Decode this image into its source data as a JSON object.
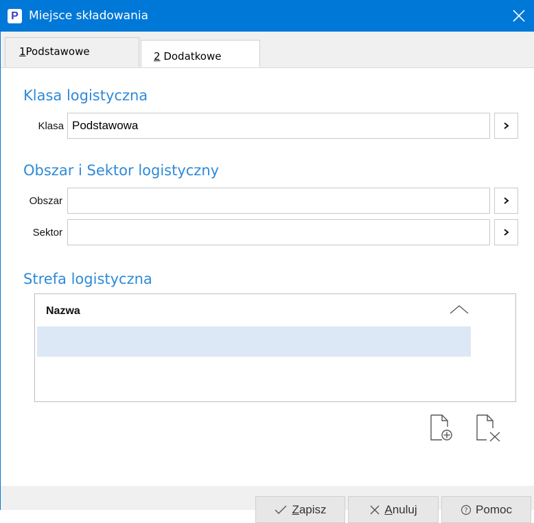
{
  "window": {
    "title": "Miejsce składowania",
    "app_icon_letter": "P"
  },
  "tabs": [
    {
      "key": "1",
      "label": "Podstawowe"
    },
    {
      "key": "2",
      "label": "Dodatkowe"
    }
  ],
  "sections": {
    "klasa_title": "Klasa logistyczna",
    "obszar_title": "Obszar i Sektor logistyczny",
    "strefa_title": "Strefa logistyczna"
  },
  "fields": {
    "klasa": {
      "label": "Klasa",
      "value": "Podstawowa"
    },
    "obszar": {
      "label": "Obszar",
      "value": ""
    },
    "sektor": {
      "label": "Sektor",
      "value": ""
    }
  },
  "grid": {
    "column_header": "Nazwa",
    "rows": [
      ""
    ]
  },
  "buttons": {
    "save_key": "Z",
    "save_rest": "apisz",
    "cancel_key": "A",
    "cancel_rest": "nuluj",
    "help": "Pomoc"
  },
  "colors": {
    "titlebar": "#0078d7",
    "section": "#2e8ad8",
    "selected_row": "#dce8f5"
  },
  "icons": [
    "close-icon",
    "chevron-right-icon",
    "sort-up-icon",
    "add-document-icon",
    "remove-document-icon",
    "checkmark-icon",
    "cross-icon",
    "help-icon"
  ]
}
